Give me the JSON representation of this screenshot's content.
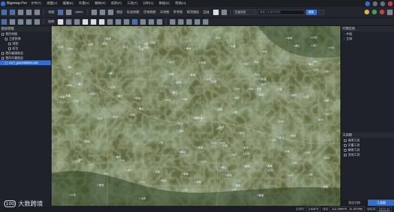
{
  "app": {
    "title": "Bigemap Pro"
  },
  "menus": [
    "文件(F)",
    "视图(V)",
    "编辑(E)",
    "矢量(V)",
    "栅格(R)",
    "投影(P)",
    "工具(T)",
    "分析(A)",
    "数据(D)",
    "帮助(H)"
  ],
  "toolbar1": {
    "map_label": "地图",
    "zoom_label": "100%",
    "labels": [
      "图层",
      "标准地图",
      "在线地图",
      "天地图",
      "参考图",
      "取消图层"
    ],
    "scale_label": "自由",
    "search_select": "百度检索",
    "search_placeholder": "请输入关键字搜索",
    "search_button": "搜索"
  },
  "toolbar2": {
    "label": "绘制"
  },
  "left_panel": {
    "title": "图层管理",
    "tree": [
      {
        "label": "我的地图",
        "level": 0
      },
      {
        "label": "卫星影像",
        "level": 1
      },
      {
        "label": "地图",
        "level": 2
      },
      {
        "label": "标注",
        "level": 2
      },
      {
        "label": "我的编辑图层",
        "level": 0
      },
      {
        "label": "我的矢量图层",
        "level": 0
      },
      {
        "label": "ACT_parcels6901.kml",
        "level": 1,
        "selected": true
      }
    ]
  },
  "right_panel": {
    "title": "行政区划",
    "items": [
      "中国",
      "全球"
    ],
    "tools_title": "工具箱",
    "tools": [
      "通用工具",
      "矢量工具",
      "栅格工具",
      "其他工具"
    ],
    "tabs": [
      "图层切换",
      "工具箱"
    ]
  },
  "map_labels": [
    "黄坡",
    "瓦窑",
    "下村",
    "石坪",
    "大屋",
    "新田",
    "岭头",
    "塘边",
    "高桥",
    "水口",
    "上坪",
    "中村",
    "竹山",
    "东岗",
    "西坑",
    "龙塘",
    "沙坝",
    "横江",
    "马岭",
    "南坑"
  ],
  "status": {
    "scale_label": "比例尺",
    "scale_value": "1:61673",
    "coord_label": "坐标",
    "coords": "112.199079 , 31.327090",
    "crs_label": "坐标系",
    "crs": "WGS 84"
  },
  "watermark": {
    "mark": "100",
    "text": "大数跨境"
  },
  "colors": {
    "accent": "#2f6fd1",
    "map_forest": "#3e5330",
    "map_field": "#6d7446"
  }
}
